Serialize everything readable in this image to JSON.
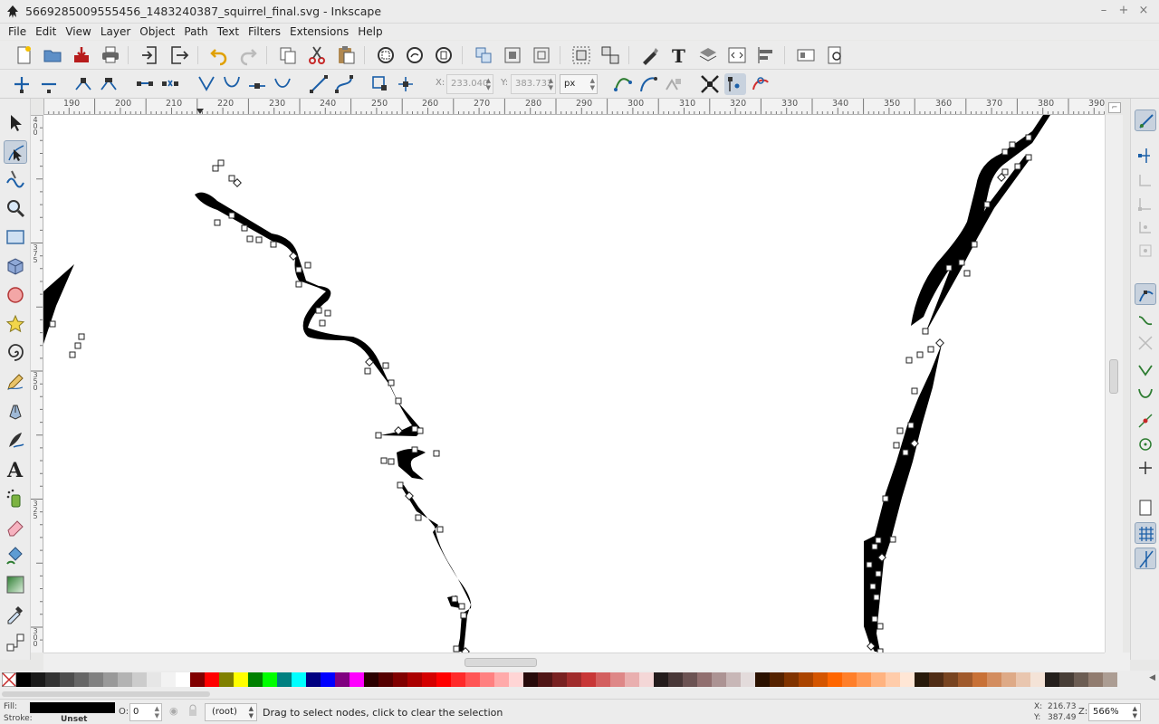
{
  "window": {
    "title": "5669285009555456_1483240387_squirrel_final.svg - Inkscape",
    "controls": [
      "–",
      "+",
      "×"
    ]
  },
  "menu": [
    "File",
    "Edit",
    "View",
    "Layer",
    "Object",
    "Path",
    "Text",
    "Filters",
    "Extensions",
    "Help"
  ],
  "node_toolbar": {
    "x_label": "X:",
    "x_value": "233.040",
    "y_label": "Y:",
    "y_value": "383.732",
    "unit": "px"
  },
  "ruler": {
    "h_labels": [
      "190",
      "200",
      "210",
      "220",
      "230",
      "240",
      "250",
      "260",
      "270",
      "280",
      "290",
      "300",
      "310",
      "320",
      "330",
      "340",
      "350",
      "360",
      "370",
      "380",
      "390"
    ],
    "v_labels": [
      "4 0 0",
      "3 7 5",
      "3 5 0",
      "3 2 5",
      "3 0 0"
    ]
  },
  "active_tool": "node-tool",
  "palette": {
    "colors": [
      "#000000",
      "#1a1a1a",
      "#333333",
      "#4d4d4d",
      "#666666",
      "#808080",
      "#999999",
      "#b3b3b3",
      "#cccccc",
      "#e6e6e6",
      "#f2f2f2",
      "#ffffff",
      "#800000",
      "#ff0000",
      "#808000",
      "#ffff00",
      "#008000",
      "#00ff00",
      "#008080",
      "#00ffff",
      "#000080",
      "#0000ff",
      "#800080",
      "#ff00ff",
      "#2b0000",
      "#550000",
      "#800000",
      "#aa0000",
      "#d40000",
      "#ff0000",
      "#ff2a2a",
      "#ff5555",
      "#ff8080",
      "#ffaaaa",
      "#ffd5d5",
      "#280b0b",
      "#501616",
      "#782121",
      "#a02c2c",
      "#c83737",
      "#d35f5f",
      "#de8787",
      "#e9afaf",
      "#f4d7d7",
      "#241c1c",
      "#483737",
      "#6c5353",
      "#916f6f",
      "#ac9393",
      "#c8b7b7",
      "#e3dbdb",
      "#2b1100",
      "#552200",
      "#803300",
      "#aa4400",
      "#d45500",
      "#ff6600",
      "#ff7f2a",
      "#ff9955",
      "#ffb380",
      "#ffccaa",
      "#ffe6d5",
      "#281a0b",
      "#502d16",
      "#784421",
      "#a05a2c",
      "#c87137",
      "#d38d5f",
      "#deaa87",
      "#e9c6af",
      "#f4e3d7",
      "#241f1c",
      "#483e37",
      "#6c5d53",
      "#917c6f",
      "#ac9d93"
    ]
  },
  "status": {
    "fill_label": "Fill:",
    "stroke_label": "Stroke:",
    "stroke_value": "Unset",
    "opacity_label": "O:",
    "opacity_value": "0",
    "layer": "(root)",
    "message": "Drag to select nodes, click to clear the selection",
    "cursor_x_label": "X:",
    "cursor_x": "216.73",
    "cursor_y_label": "Y:",
    "cursor_y": "387.49",
    "zoom_label": "Z:",
    "zoom": "566%"
  }
}
